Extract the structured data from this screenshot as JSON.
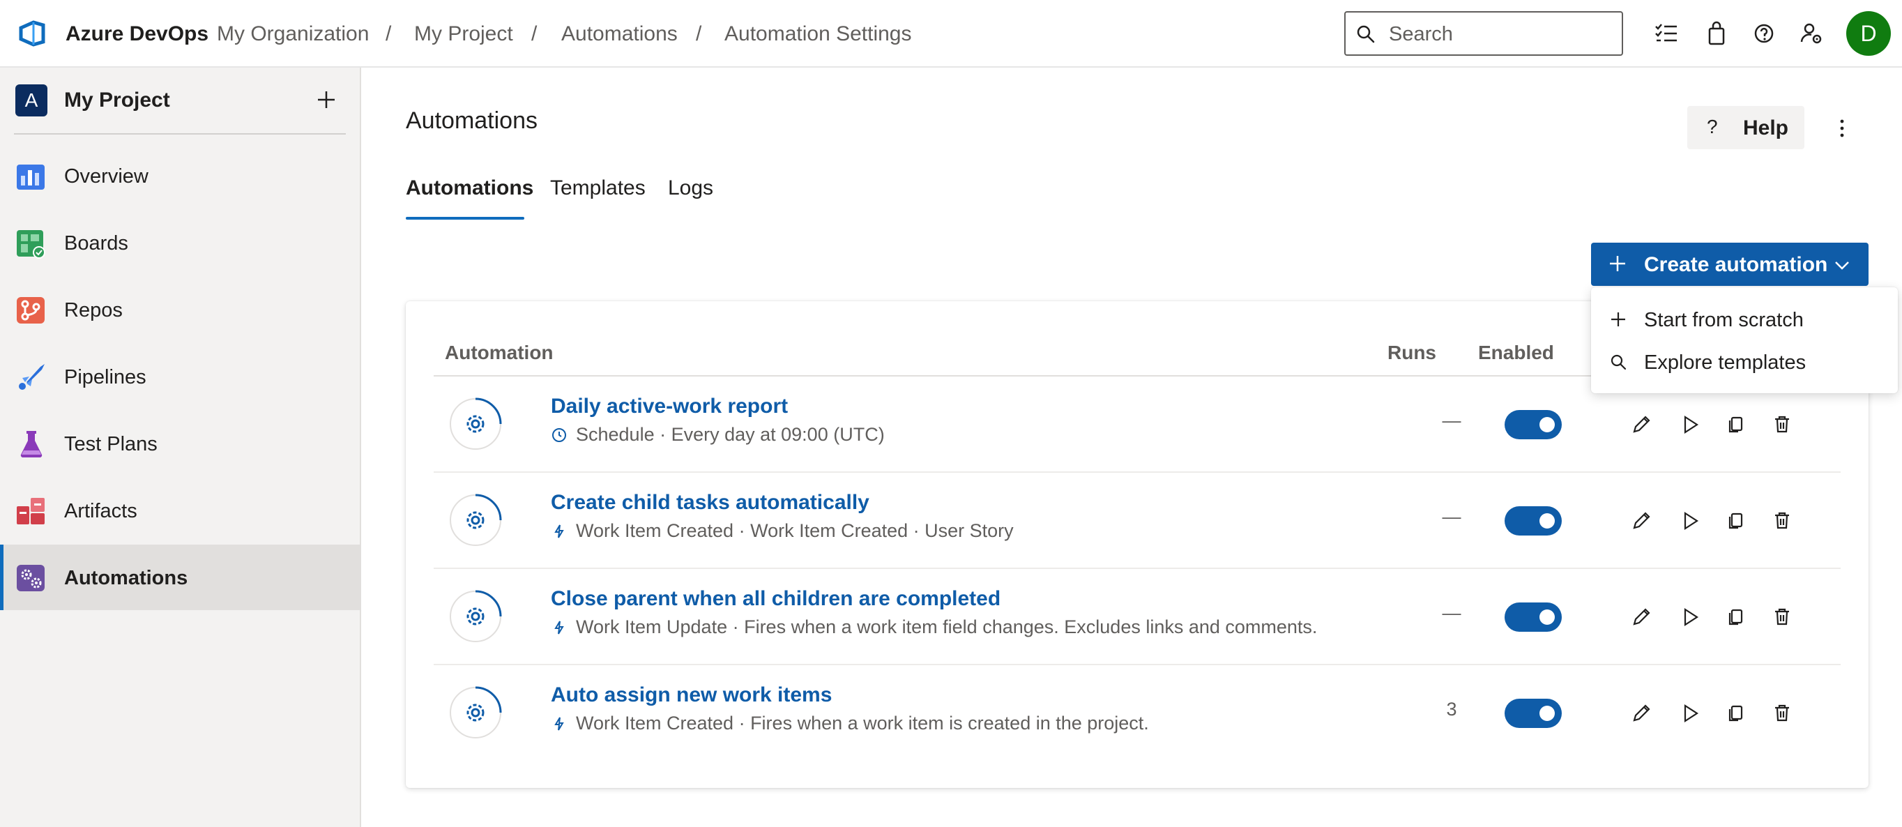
{
  "header": {
    "brand": "Azure DevOps",
    "breadcrumbs": [
      "My Organization",
      "My Project",
      "Automations",
      "Automation Settings"
    ],
    "search_placeholder": "Search",
    "avatar_initial": "D"
  },
  "sidebar": {
    "project_initial": "A",
    "project_name": "My Project",
    "items": [
      {
        "label": "Overview",
        "icon": "overview-icon"
      },
      {
        "label": "Boards",
        "icon": "boards-icon"
      },
      {
        "label": "Repos",
        "icon": "repos-icon"
      },
      {
        "label": "Pipelines",
        "icon": "pipelines-icon"
      },
      {
        "label": "Test Plans",
        "icon": "test-plans-icon"
      },
      {
        "label": "Artifacts",
        "icon": "artifacts-icon"
      },
      {
        "label": "Automations",
        "icon": "automations-icon",
        "active": true
      }
    ]
  },
  "main": {
    "title": "Automations",
    "help_label": "Help",
    "help_glyph": "?",
    "tabs": [
      {
        "label": "Automations",
        "active": true
      },
      {
        "label": "Templates"
      },
      {
        "label": "Logs"
      }
    ],
    "create_label": "Create automation",
    "dropdown": [
      {
        "label": "Start from scratch",
        "icon": "plus-icon"
      },
      {
        "label": "Explore templates",
        "icon": "search-icon"
      }
    ],
    "table": {
      "headers": {
        "automation": "Automation",
        "runs": "Runs",
        "enabled": "Enabled"
      },
      "rows": [
        {
          "name": "Daily active-work report",
          "trigger_icon": "clock-icon",
          "subtitle": "Schedule · Every day at 09:00 (UTC)",
          "runs": "—",
          "enabled": true
        },
        {
          "name": "Create child tasks automatically",
          "trigger_icon": "lightning-icon",
          "subtitle": "Work Item Created · Work Item Created · User Story",
          "runs": "—",
          "enabled": true
        },
        {
          "name": "Close parent when all children are completed",
          "trigger_icon": "lightning-icon",
          "subtitle": "Work Item Update · Fires when a work item field changes. Excludes links and comments.",
          "runs": "—",
          "enabled": true
        },
        {
          "name": "Auto assign new work items",
          "trigger_icon": "lightning-icon",
          "subtitle": "Work Item Created · Fires when a work item is created in the project.",
          "runs": "3",
          "enabled": true
        }
      ]
    }
  },
  "colors": {
    "accent": "#0f5ca8",
    "link": "#0f5ca8",
    "avatar": "#107c10",
    "project_badge": "#0b2c5f"
  }
}
